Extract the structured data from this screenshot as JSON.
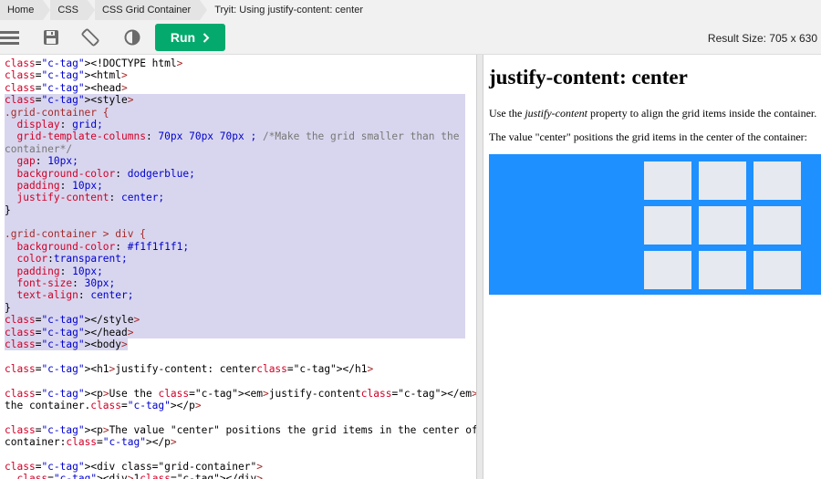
{
  "breadcrumbs": [
    "Home",
    "CSS",
    "CSS Grid Container",
    "Tryit: Using justify-content: center"
  ],
  "toolbar": {
    "run_label": "Run",
    "result_size": "Result Size: 705 x 630",
    "icons": [
      "menu-icon",
      "save-icon",
      "rotate-icon",
      "theme-contrast-icon",
      "chevron-right-icon"
    ]
  },
  "code_lines": [
    "<!DOCTYPE html>",
    "<html>",
    "<head>",
    "<style>",
    ".grid-container {",
    "  display: grid;",
    "  grid-template-columns: 70px 70px 70px ; /*Make the grid smaller than the",
    "container*/",
    "  gap: 10px;",
    "  background-color: dodgerblue;",
    "  padding: 10px;",
    "  justify-content: center;",
    "}",
    "",
    ".grid-container > div {",
    "  background-color: #f1f1f1f1;",
    "  color:transparent;",
    "  padding: 10px;",
    "  font-size: 30px;",
    "  text-align: center;",
    "}",
    "</style>",
    "</head>",
    "<body>",
    "",
    "<h1>justify-content: center</h1>",
    "",
    "<p>Use the <em>justify-content</em> property to align the grid items inside",
    "the container.</p>",
    "",
    "<p>The value \"center\" positions the grid items in the center of the",
    "container:</p>",
    "",
    "<div class=\"grid-container\">",
    "  <div>1</div>"
  ],
  "result": {
    "heading": "justify-content: center",
    "p1_before": "Use the ",
    "p1_em": "justify-content",
    "p1_after": " property to align the grid items inside the container.",
    "p2": "The value \"center\" positions the grid items in the center of the container:",
    "grid_item_count": 9
  },
  "colors": {
    "run_button": "#04aa6d",
    "grid_background": "#1e90ff",
    "grid_item": "#e6e9ef",
    "selection": "#d8d6ee"
  }
}
